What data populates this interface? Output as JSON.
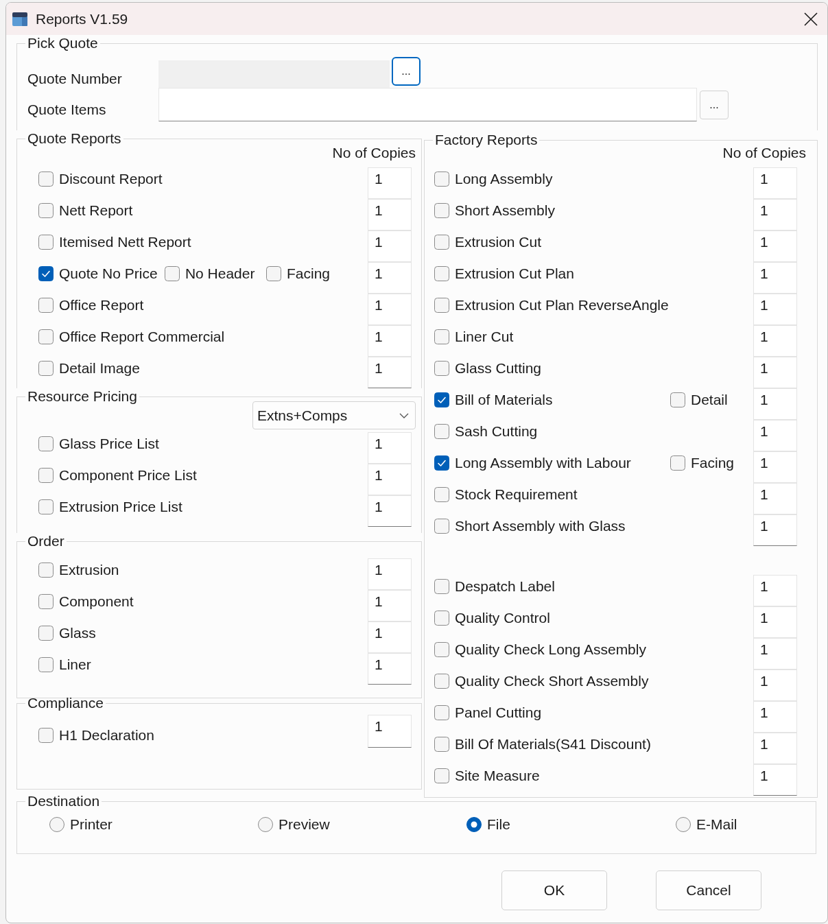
{
  "window": {
    "title": "Reports V1.59"
  },
  "pick_quote": {
    "title": "Pick Quote",
    "fields": [
      {
        "label": "Quote Number",
        "disabled": true,
        "button": "...",
        "button_focused": true
      },
      {
        "label": "Quote Items",
        "disabled": false,
        "button": "...",
        "button_focused": false
      }
    ]
  },
  "quote_reports": {
    "title": "Quote Reports",
    "copies_header": "No of Copies",
    "items": [
      {
        "label": "Discount Report",
        "checked": false,
        "copies": "1"
      },
      {
        "label": "Nett Report",
        "checked": false,
        "copies": "1"
      },
      {
        "label": "Itemised Nett Report",
        "checked": false,
        "copies": "1"
      },
      {
        "label": "Quote No Price",
        "checked": true,
        "copies": "1",
        "extras": [
          {
            "label": "No Header",
            "checked": false
          },
          {
            "label": "Facing",
            "checked": false
          }
        ]
      },
      {
        "label": "Office Report",
        "checked": false,
        "copies": "1"
      },
      {
        "label": "Office Report Commercial",
        "checked": false,
        "copies": "1"
      },
      {
        "label": "Detail Image",
        "checked": false,
        "copies": "1"
      }
    ]
  },
  "resource_pricing": {
    "title": "Resource Pricing",
    "dropdown": "Extns+Comps",
    "items": [
      {
        "label": "Glass Price List",
        "checked": false,
        "copies": "1"
      },
      {
        "label": "Component Price List",
        "checked": false,
        "copies": "1"
      },
      {
        "label": "Extrusion Price List",
        "checked": false,
        "copies": "1"
      }
    ]
  },
  "order": {
    "title": "Order",
    "items": [
      {
        "label": "Extrusion",
        "checked": false,
        "copies": "1"
      },
      {
        "label": "Component",
        "checked": false,
        "copies": "1"
      },
      {
        "label": "Glass",
        "checked": false,
        "copies": "1"
      },
      {
        "label": "Liner",
        "checked": false,
        "copies": "1"
      }
    ]
  },
  "compliance": {
    "title": "Compliance",
    "items": [
      {
        "label": "H1 Declaration",
        "checked": false,
        "copies": "1"
      }
    ]
  },
  "factory_reports": {
    "title": "Factory Reports",
    "copies_header": "No of Copies",
    "sections": [
      {
        "items": [
          {
            "label": "Long Assembly",
            "checked": false,
            "copies": "1"
          },
          {
            "label": "Short Assembly",
            "checked": false,
            "copies": "1"
          },
          {
            "label": "Extrusion Cut",
            "checked": false,
            "copies": "1"
          },
          {
            "label": "Extrusion Cut Plan",
            "checked": false,
            "copies": "1"
          },
          {
            "label": "Extrusion Cut Plan ReverseAngle",
            "checked": false,
            "copies": "1"
          },
          {
            "label": "Liner Cut",
            "checked": false,
            "copies": "1"
          },
          {
            "label": "Glass Cutting",
            "checked": false,
            "copies": "1"
          },
          {
            "label": "Bill of Materials",
            "checked": true,
            "copies": "1",
            "extras": [
              {
                "label": "Detail",
                "checked": false
              }
            ]
          },
          {
            "label": "Sash Cutting",
            "checked": false,
            "copies": "1"
          },
          {
            "label": "Long Assembly with Labour",
            "checked": true,
            "copies": "1",
            "extras": [
              {
                "label": "Facing",
                "checked": false
              }
            ]
          },
          {
            "label": "Stock Requirement",
            "checked": false,
            "copies": "1"
          },
          {
            "label": "Short Assembly with Glass",
            "checked": false,
            "copies": "1"
          }
        ]
      },
      {
        "items": [
          {
            "label": "Despatch Label",
            "checked": false,
            "copies": "1"
          },
          {
            "label": "Quality Control",
            "checked": false,
            "copies": "1"
          },
          {
            "label": "Quality Check Long Assembly",
            "checked": false,
            "copies": "1"
          },
          {
            "label": "Quality Check Short Assembly",
            "checked": false,
            "copies": "1"
          },
          {
            "label": "Panel Cutting",
            "checked": false,
            "copies": "1"
          },
          {
            "label": "Bill Of Materials(S41 Discount)",
            "checked": false,
            "copies": "1"
          },
          {
            "label": "Site Measure",
            "checked": false,
            "copies": "1"
          }
        ]
      }
    ]
  },
  "destination": {
    "title": "Destination",
    "options": [
      {
        "label": "Printer",
        "selected": false
      },
      {
        "label": "Preview",
        "selected": false
      },
      {
        "label": "File",
        "selected": true
      },
      {
        "label": "E-Mail",
        "selected": false
      }
    ]
  },
  "buttons": [
    {
      "label": "OK"
    },
    {
      "label": "Cancel"
    }
  ]
}
